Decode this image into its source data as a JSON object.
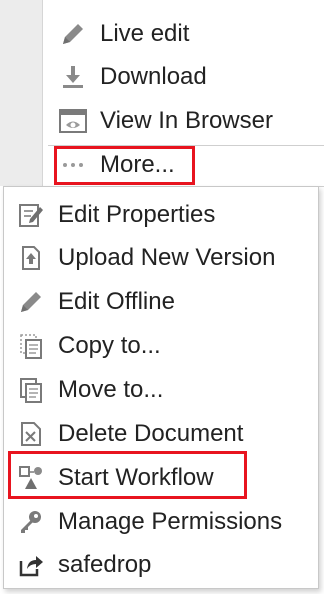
{
  "actions": {
    "live_edit": {
      "label": "Live edit",
      "icon": "pencil-icon"
    },
    "download": {
      "label": "Download",
      "icon": "download-icon"
    },
    "view_in_browser": {
      "label": "View In Browser",
      "icon": "view-in-browser-icon"
    },
    "more": {
      "label": "More...",
      "icon": "ellipsis-icon"
    }
  },
  "menu": {
    "items": [
      {
        "label": "Edit Properties",
        "icon": "edit-properties-icon"
      },
      {
        "label": "Upload New Version",
        "icon": "upload-icon"
      },
      {
        "label": "Edit Offline",
        "icon": "pencil-icon"
      },
      {
        "label": "Copy to...",
        "icon": "copy-icon"
      },
      {
        "label": "Move to...",
        "icon": "move-icon"
      },
      {
        "label": "Delete Document",
        "icon": "delete-document-icon"
      },
      {
        "label": "Start Workflow",
        "icon": "workflow-icon"
      },
      {
        "label": "Manage Permissions",
        "icon": "key-icon"
      },
      {
        "label": "safedrop",
        "icon": "share-icon"
      }
    ]
  },
  "colors": {
    "highlight": "#e8141f",
    "icon_gray": "#8a8a8a",
    "text": "#222222"
  }
}
